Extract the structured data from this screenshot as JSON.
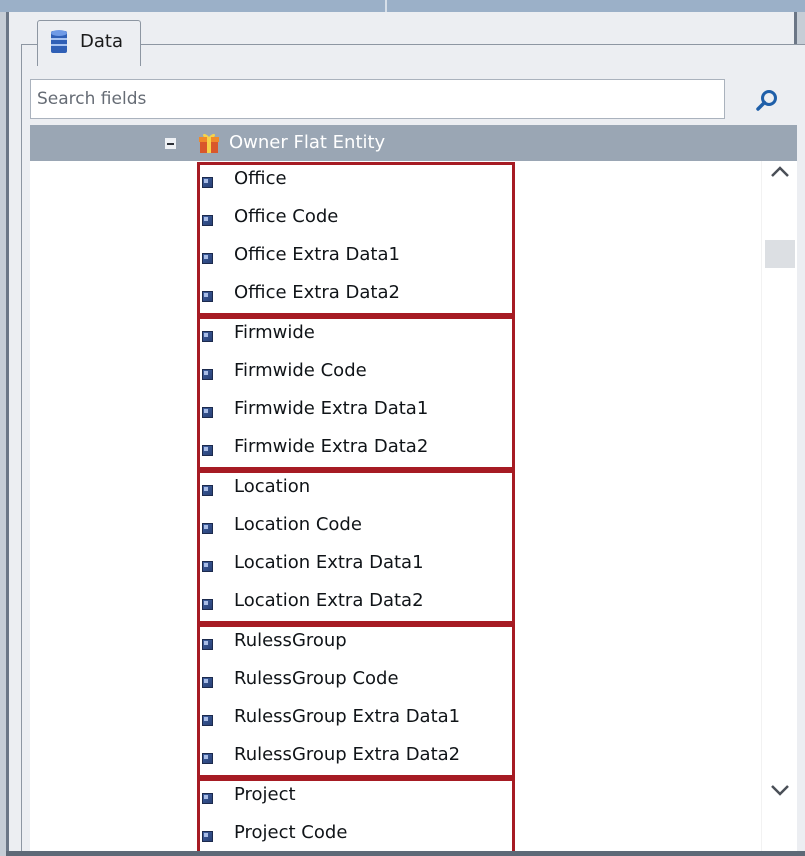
{
  "panel": {
    "tab_label": "Data",
    "tab_icon": "database-icon"
  },
  "search": {
    "placeholder": "Search fields",
    "value": "",
    "button_icon": "search-icon"
  },
  "tree": {
    "entity": {
      "label": "Owner Flat Entity",
      "icon": "gift-box-icon",
      "expanded": true
    },
    "groups": [
      {
        "name": "office",
        "fields": [
          "Office",
          "Office Code",
          "Office Extra Data1",
          "Office Extra Data2"
        ]
      },
      {
        "name": "firmwide",
        "fields": [
          "Firmwide",
          "Firmwide Code",
          "Firmwide Extra Data1",
          "Firmwide Extra Data2"
        ]
      },
      {
        "name": "location",
        "fields": [
          "Location",
          "Location Code",
          "Location Extra Data1",
          "Location Extra Data2"
        ]
      },
      {
        "name": "rulessgroup",
        "fields": [
          "RulessGroup",
          "RulessGroup Code",
          "RulessGroup Extra Data1",
          "RulessGroup Extra Data2"
        ]
      },
      {
        "name": "project",
        "fields": [
          "Project",
          "Project Code"
        ]
      }
    ]
  },
  "scrollbar": {
    "up_icon": "chevron-up-icon",
    "down_icon": "chevron-down-icon"
  },
  "colors": {
    "highlight_border": "#a61b23",
    "header_background": "#9aa6b4",
    "field_icon": "#2e4a86"
  }
}
